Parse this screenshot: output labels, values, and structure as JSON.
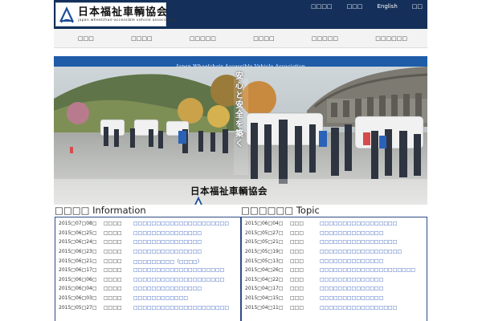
{
  "header": {
    "logo_title": "日本福祉車輌協会",
    "logo_subtitle": "japan wheelchair-accessible vehicle association",
    "util_links": [
      "□□□□",
      "□□□",
      "English",
      "□□"
    ]
  },
  "main_nav": [
    "□□□",
    "□□□□",
    "□□□□□",
    "□□□□",
    "□□□□□",
    "□□□□□□"
  ],
  "banner": {
    "strip_text": "Japan Wheelchair-Accessible Vehicle Association",
    "slogan": "安心と安全を築く",
    "logo_text": "日本福祉車輌協会"
  },
  "info": {
    "title": "□□□□ Information",
    "items": [
      {
        "date": "2015□07□08□",
        "category": "□□□□",
        "title": "□□□□□□□□□□□□□□□□□□□□□"
      },
      {
        "date": "2015□06□25□",
        "category": "□□□□",
        "title": "□□□□□□□□□□□□□□□"
      },
      {
        "date": "2015□06□24□",
        "category": "□□□□",
        "title": "□□□□□□□□□□□□□□□"
      },
      {
        "date": "2015□06□23□",
        "category": "□□□□",
        "title": "□□□□□□□□□□□□□□□"
      },
      {
        "date": "2015□06□21□",
        "category": "□□□□",
        "title": "□□□□□□□□□（□□□□）"
      },
      {
        "date": "2015□06□17□",
        "category": "□□□□",
        "title": "□□□□□□□□□□□□□□□□□□□□"
      },
      {
        "date": "2015□06□06□",
        "category": "□□□□",
        "title": "□□□□□□□□□□□□□□□□□□□□"
      },
      {
        "date": "2015□06□04□",
        "category": "□□□□",
        "title": "□□□□□□□□□□□□□□□"
      },
      {
        "date": "2015□06□03□",
        "category": "□□□□",
        "title": "□□□□□□□□□□□□"
      },
      {
        "date": "2015□05□27□",
        "category": "□□□□",
        "title": "□□□□□□□□□□□□□□□□□□□□□"
      }
    ]
  },
  "topic": {
    "title": "□□□□□□ Topic",
    "items": [
      {
        "date": "2015□06□04□",
        "category": "□□□",
        "title": "□□□□□□□□□□□□□□□□□"
      },
      {
        "date": "2015□05□27□",
        "category": "□□□",
        "title": "□□□□□□□□□□□□□□"
      },
      {
        "date": "2015□05□21□",
        "category": "□□□",
        "title": "□□□□□□□□□□□□□□□□□"
      },
      {
        "date": "2015□05□19□",
        "category": "□□□",
        "title": "□□□□□□□□□□□□□□□□□□"
      },
      {
        "date": "2015□05□13□",
        "category": "□□□",
        "title": "□□□□□□□□□□□□□□"
      },
      {
        "date": "2015□04□26□",
        "category": "□□□",
        "title": "□□□□□□□□□□□□□□□□□□□□□"
      },
      {
        "date": "2015□04□22□",
        "category": "□□□",
        "title": "□□□□□□□□□□□□□□"
      },
      {
        "date": "2015□04□17□",
        "category": "□□□",
        "title": "□□□□□□□□□□□□□□"
      },
      {
        "date": "2015□04□15□",
        "category": "□□□",
        "title": "□□□□□□□□□□□□□□"
      },
      {
        "date": "2015□04□11□",
        "category": "□□□",
        "title": "□□□□□□□□□□□□□□□□□"
      }
    ]
  },
  "colors": {
    "header_bg": "#14305a",
    "strip_bg": "#1f5ca8",
    "link": "#2a56b8",
    "panel_border": "#2d4c86"
  },
  "icons": [
    "wheelchair-logo-icon"
  ]
}
